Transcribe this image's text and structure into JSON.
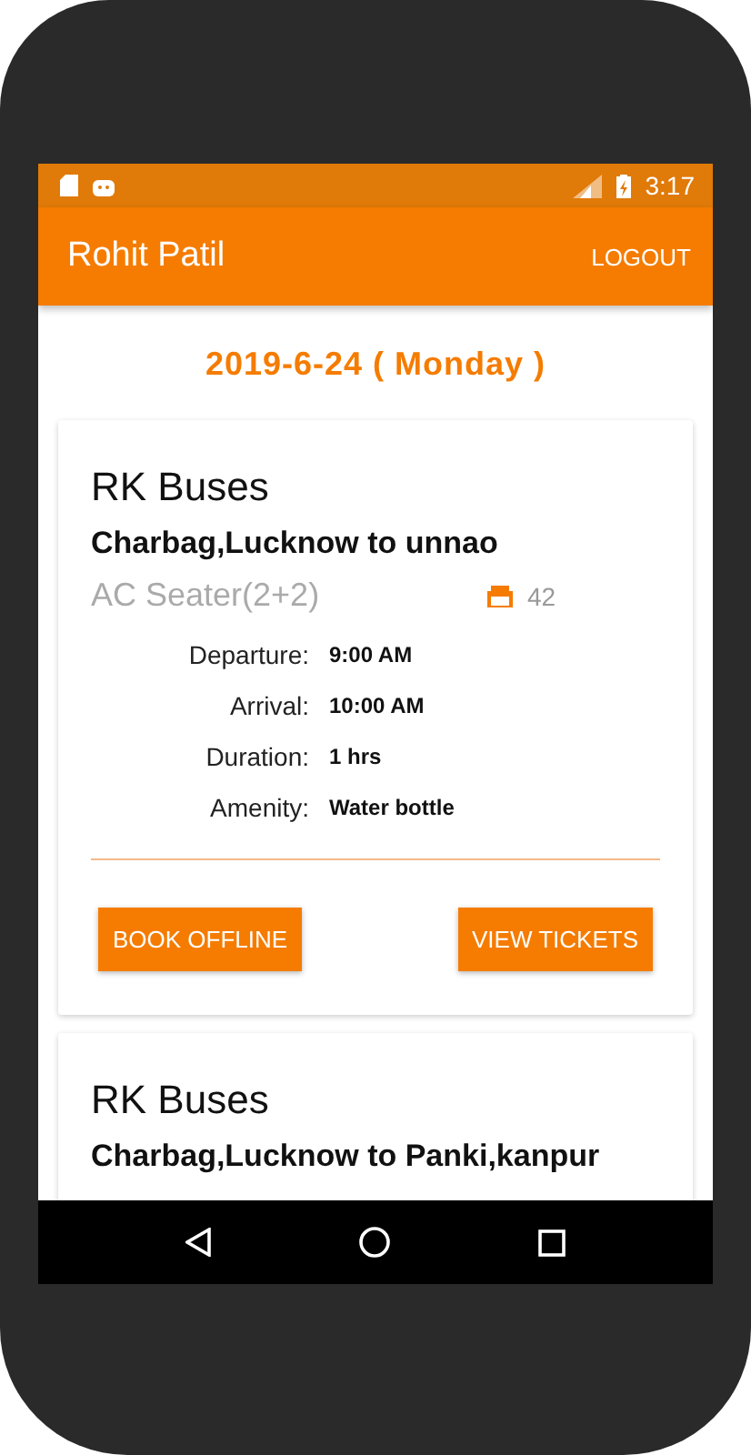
{
  "status_bar": {
    "time": "3:17"
  },
  "app_bar": {
    "title": "Rohit Patil",
    "action": "LOGOUT"
  },
  "date_heading": "2019-6-24 ( Monday )",
  "buses": [
    {
      "operator": "RK Buses",
      "route": "Charbag,Lucknow to unnao",
      "bus_type": "AC Seater(2+2)",
      "seats": "42",
      "details": [
        {
          "label": "Departure:",
          "value": "9:00 AM"
        },
        {
          "label": "Arrival:",
          "value": "10:00 AM"
        },
        {
          "label": "Duration:",
          "value": "1 hrs"
        },
        {
          "label": "Amenity:",
          "value": "Water bottle"
        }
      ],
      "buttons": [
        "BOOK OFFLINE",
        "VIEW TICKETS"
      ]
    },
    {
      "operator": "RK Buses",
      "route": "Charbag,Lucknow to Panki,kanpur"
    }
  ]
}
